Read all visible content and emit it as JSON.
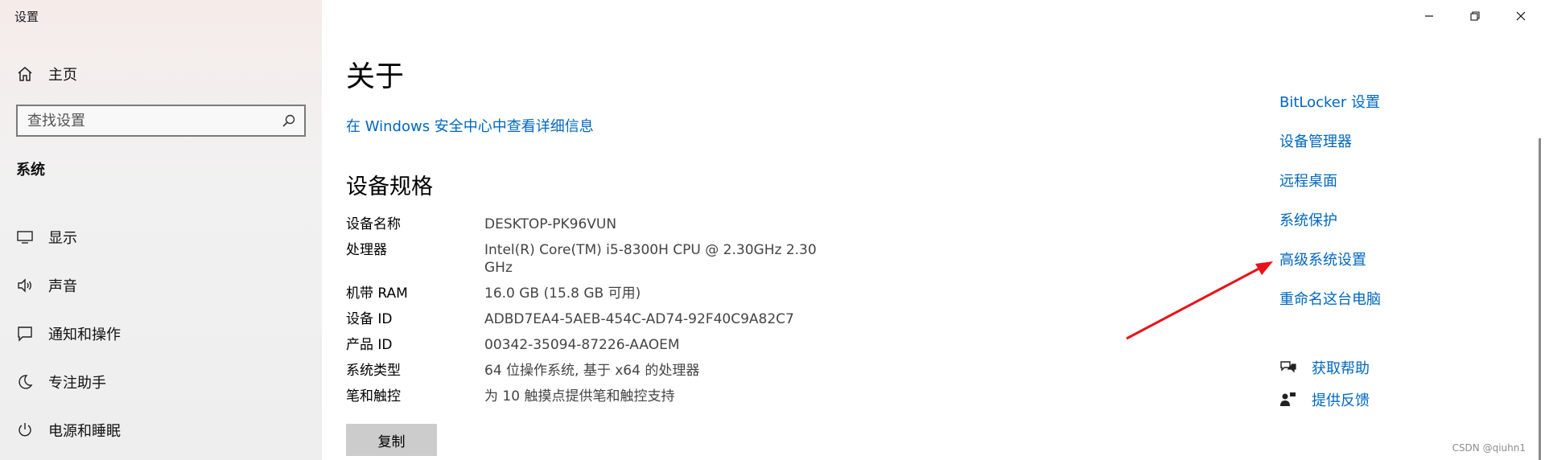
{
  "window": {
    "title": "设置",
    "controls": [
      "minimize-icon",
      "restore-icon",
      "close-icon"
    ]
  },
  "sidebar": {
    "home_label": "主页",
    "search_placeholder": "查找设置",
    "section_label": "系统",
    "items": [
      {
        "label": "显示",
        "icon": "display-icon"
      },
      {
        "label": "声音",
        "icon": "speaker-icon"
      },
      {
        "label": "通知和操作",
        "icon": "notification-icon"
      },
      {
        "label": "专注助手",
        "icon": "moon-icon"
      },
      {
        "label": "电源和睡眠",
        "icon": "power-icon"
      }
    ]
  },
  "main": {
    "title": "关于",
    "security_link": "在 Windows 安全中心中查看详细信息",
    "spec_title": "设备规格",
    "specs": [
      {
        "key": "设备名称",
        "value": "DESKTOP-PK96VUN"
      },
      {
        "key": "处理器",
        "value": "Intel(R) Core(TM) i5-8300H CPU @ 2.30GHz   2.30 GHz"
      },
      {
        "key": "机带 RAM",
        "value": "16.0 GB (15.8 GB 可用)"
      },
      {
        "key": "设备 ID",
        "value": "ADBD7EA4-5AEB-454C-AD74-92F40C9A82C7"
      },
      {
        "key": "产品 ID",
        "value": "00342-35094-87226-AAOEM"
      },
      {
        "key": "系统类型",
        "value": "64 位操作系统, 基于 x64 的处理器"
      },
      {
        "key": "笔和触控",
        "value": "为 10 触摸点提供笔和触控支持"
      }
    ],
    "copy_label": "复制"
  },
  "related": {
    "links": [
      "BitLocker 设置",
      "设备管理器",
      "远程桌面",
      "系统保护",
      "高级系统设置",
      "重命名这台电脑"
    ],
    "help_label": "获取帮助",
    "feedback_label": "提供反馈"
  },
  "annotation": {
    "arrow_color": "#e8131a"
  },
  "watermark": "CSDN @qiuhn1",
  "colors": {
    "link": "#0067c0",
    "accent": "#0067c0"
  }
}
